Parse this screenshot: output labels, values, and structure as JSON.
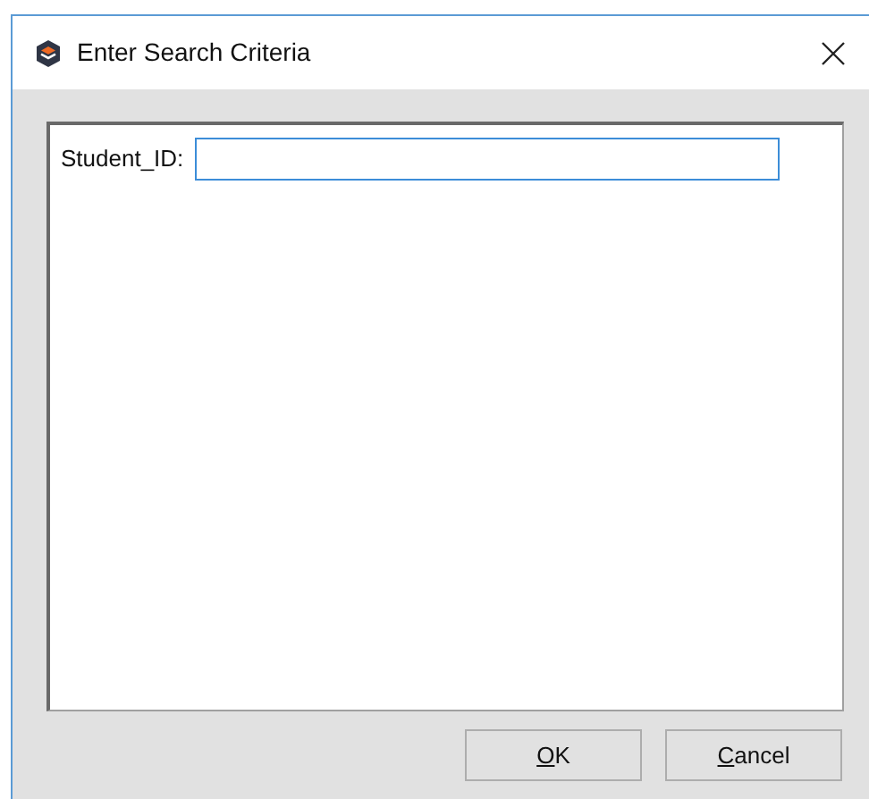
{
  "window": {
    "title": "Enter Search Criteria"
  },
  "fields": [
    {
      "label": "Student_ID:",
      "focused": true
    }
  ],
  "buttons": [
    {
      "access_key": "O",
      "label_rest": "K"
    },
    {
      "access_key": "C",
      "label_rest": "ancel"
    }
  ]
}
